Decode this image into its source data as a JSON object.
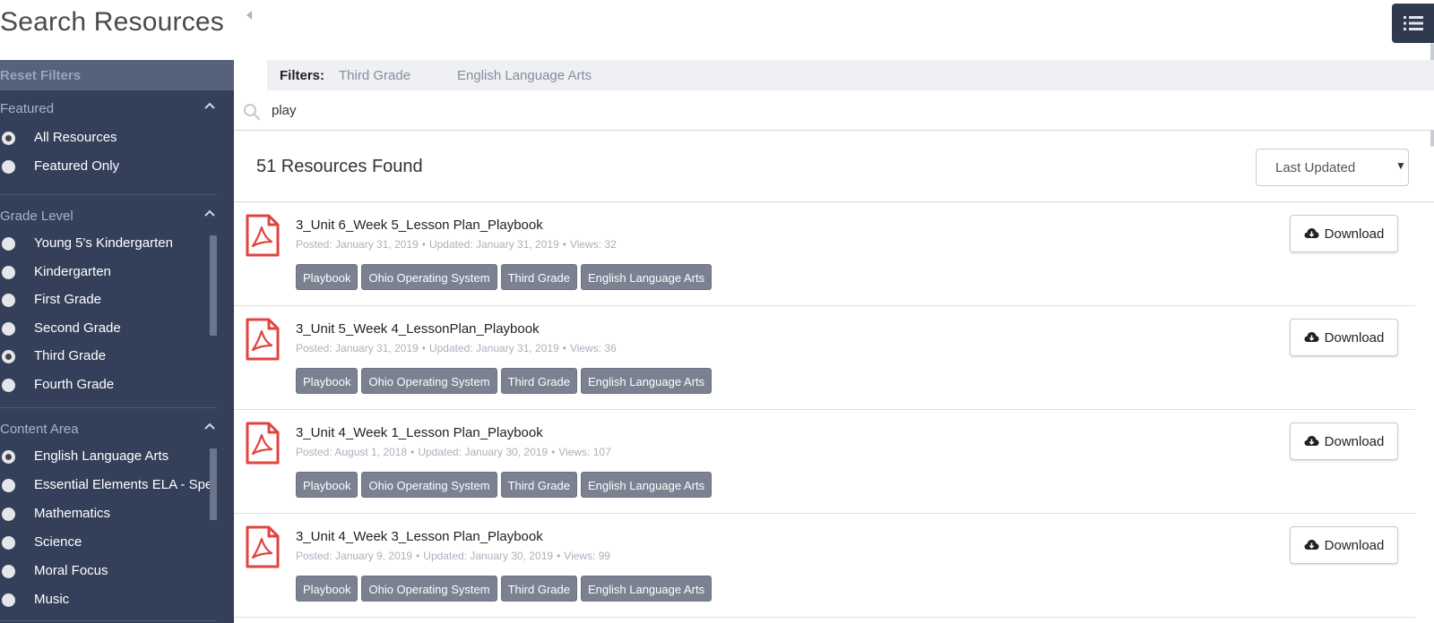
{
  "header": {
    "title": "Search Resources",
    "menu_icon": "list-icon"
  },
  "sidebar": {
    "reset_label": "Reset Filters",
    "sections": [
      {
        "title": "Featured",
        "options": [
          {
            "label": "All Resources",
            "checked": true
          },
          {
            "label": "Featured Only",
            "checked": false
          }
        ]
      },
      {
        "title": "Grade Level",
        "options": [
          {
            "label": "Young 5's Kindergarten",
            "checked": false
          },
          {
            "label": "Kindergarten",
            "checked": false
          },
          {
            "label": "First Grade",
            "checked": false
          },
          {
            "label": "Second Grade",
            "checked": false
          },
          {
            "label": "Third Grade",
            "checked": true
          },
          {
            "label": "Fourth Grade",
            "checked": false
          }
        ]
      },
      {
        "title": "Content Area",
        "options": [
          {
            "label": "English Language Arts",
            "checked": true
          },
          {
            "label": "Essential Elements ELA - Spe",
            "checked": false
          },
          {
            "label": "Mathematics",
            "checked": false
          },
          {
            "label": "Science",
            "checked": false
          },
          {
            "label": "Moral Focus",
            "checked": false
          },
          {
            "label": "Music",
            "checked": false
          }
        ]
      }
    ]
  },
  "filters": {
    "label": "Filters:",
    "active": [
      "Third Grade",
      "English Language Arts"
    ]
  },
  "search": {
    "value": "play",
    "icon": "search-icon"
  },
  "results": {
    "count_label": "51 Resources Found",
    "sort": {
      "selected": "Last Updated"
    },
    "download_label": "Download",
    "items": [
      {
        "title": "3_Unit 6_Week 5_Lesson Plan_Playbook",
        "posted": "Posted: January 31, 2019",
        "updated": "Updated: January 31, 2019",
        "views": "Views: 32",
        "tags": [
          "Playbook",
          "Ohio Operating System",
          "Third Grade",
          "English Language Arts"
        ]
      },
      {
        "title": "3_Unit 5_Week 4_LessonPlan_Playbook",
        "posted": "Posted: January 31, 2019",
        "updated": "Updated: January 31, 2019",
        "views": "Views: 36",
        "tags": [
          "Playbook",
          "Ohio Operating System",
          "Third Grade",
          "English Language Arts"
        ]
      },
      {
        "title": "3_Unit 4_Week 1_Lesson Plan_Playbook",
        "posted": "Posted: August 1, 2018",
        "updated": "Updated: January 30, 2019",
        "views": "Views: 107",
        "tags": [
          "Playbook",
          "Ohio Operating System",
          "Third Grade",
          "English Language Arts"
        ]
      },
      {
        "title": "3_Unit 4_Week 3_Lesson Plan_Playbook",
        "posted": "Posted: January 9, 2019",
        "updated": "Updated: January 30, 2019",
        "views": "Views: 99",
        "tags": [
          "Playbook",
          "Ohio Operating System",
          "Third Grade",
          "English Language Arts"
        ]
      }
    ]
  },
  "colors": {
    "sidebar_bg": "#34405a",
    "reset_bar_bg": "#56627c",
    "tag_bg": "#7b8191",
    "pdf_red": "#e0443e",
    "menu_button_bg": "#2f3a4e"
  }
}
